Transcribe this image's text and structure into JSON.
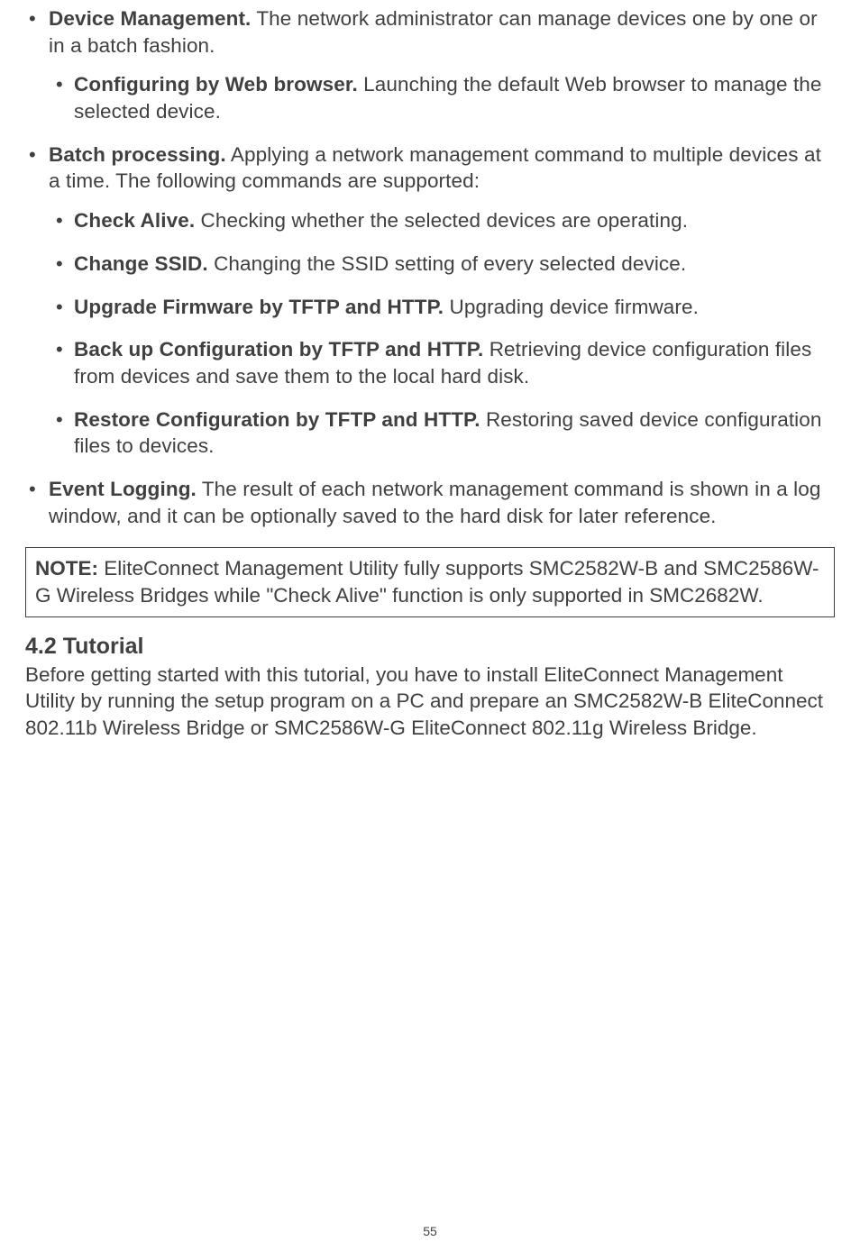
{
  "bullets": {
    "device_mgmt": {
      "title": "Device Management.",
      "text": " The network administrator can manage devices one by one or in a batch fashion."
    },
    "config_web": {
      "title": "Configuring by Web browser.",
      "text": " Launching the default Web browser to manage the selected device."
    },
    "batch_proc": {
      "title": "Batch processing.",
      "text": " Applying a network management command to multiple devices at a time. The following commands are supported:"
    },
    "check_alive": {
      "title": "Check Alive.",
      "text": " Checking whether the selected devices are operating."
    },
    "change_ssid": {
      "title": "Change SSID.",
      "text": " Changing the SSID setting of every selected device."
    },
    "upgrade_fw": {
      "title": "Upgrade Firmware by TFTP and HTTP.",
      "text": " Upgrading device firmware."
    },
    "backup_cfg": {
      "title": "Back up Configuration by TFTP and HTTP.",
      "text": " Retrieving device configuration files from devices and save them to the local hard disk."
    },
    "restore_cfg": {
      "title": "Restore Configuration by TFTP and HTTP.",
      "text": " Restoring saved device configuration files to devices."
    },
    "event_log": {
      "title": "Event Logging.",
      "text": " The result of each network management command is shown in a log window, and it can be optionally saved to the hard disk for later reference."
    }
  },
  "note": {
    "label": "NOTE:",
    "text": " EliteConnect Management Utility fully supports SMC2582W-B and SMC2586W-G Wireless Bridges while \"Check Alive\" function is only supported in SMC2682W."
  },
  "section": {
    "heading": "4.2 Tutorial",
    "body": "Before getting started with this tutorial, you have to install EliteConnect Management Utility by running the setup program on a PC and prepare an SMC2582W-B EliteConnect 802.11b Wireless Bridge or SMC2586W-G EliteConnect 802.11g Wireless Bridge."
  },
  "page_number": "55"
}
